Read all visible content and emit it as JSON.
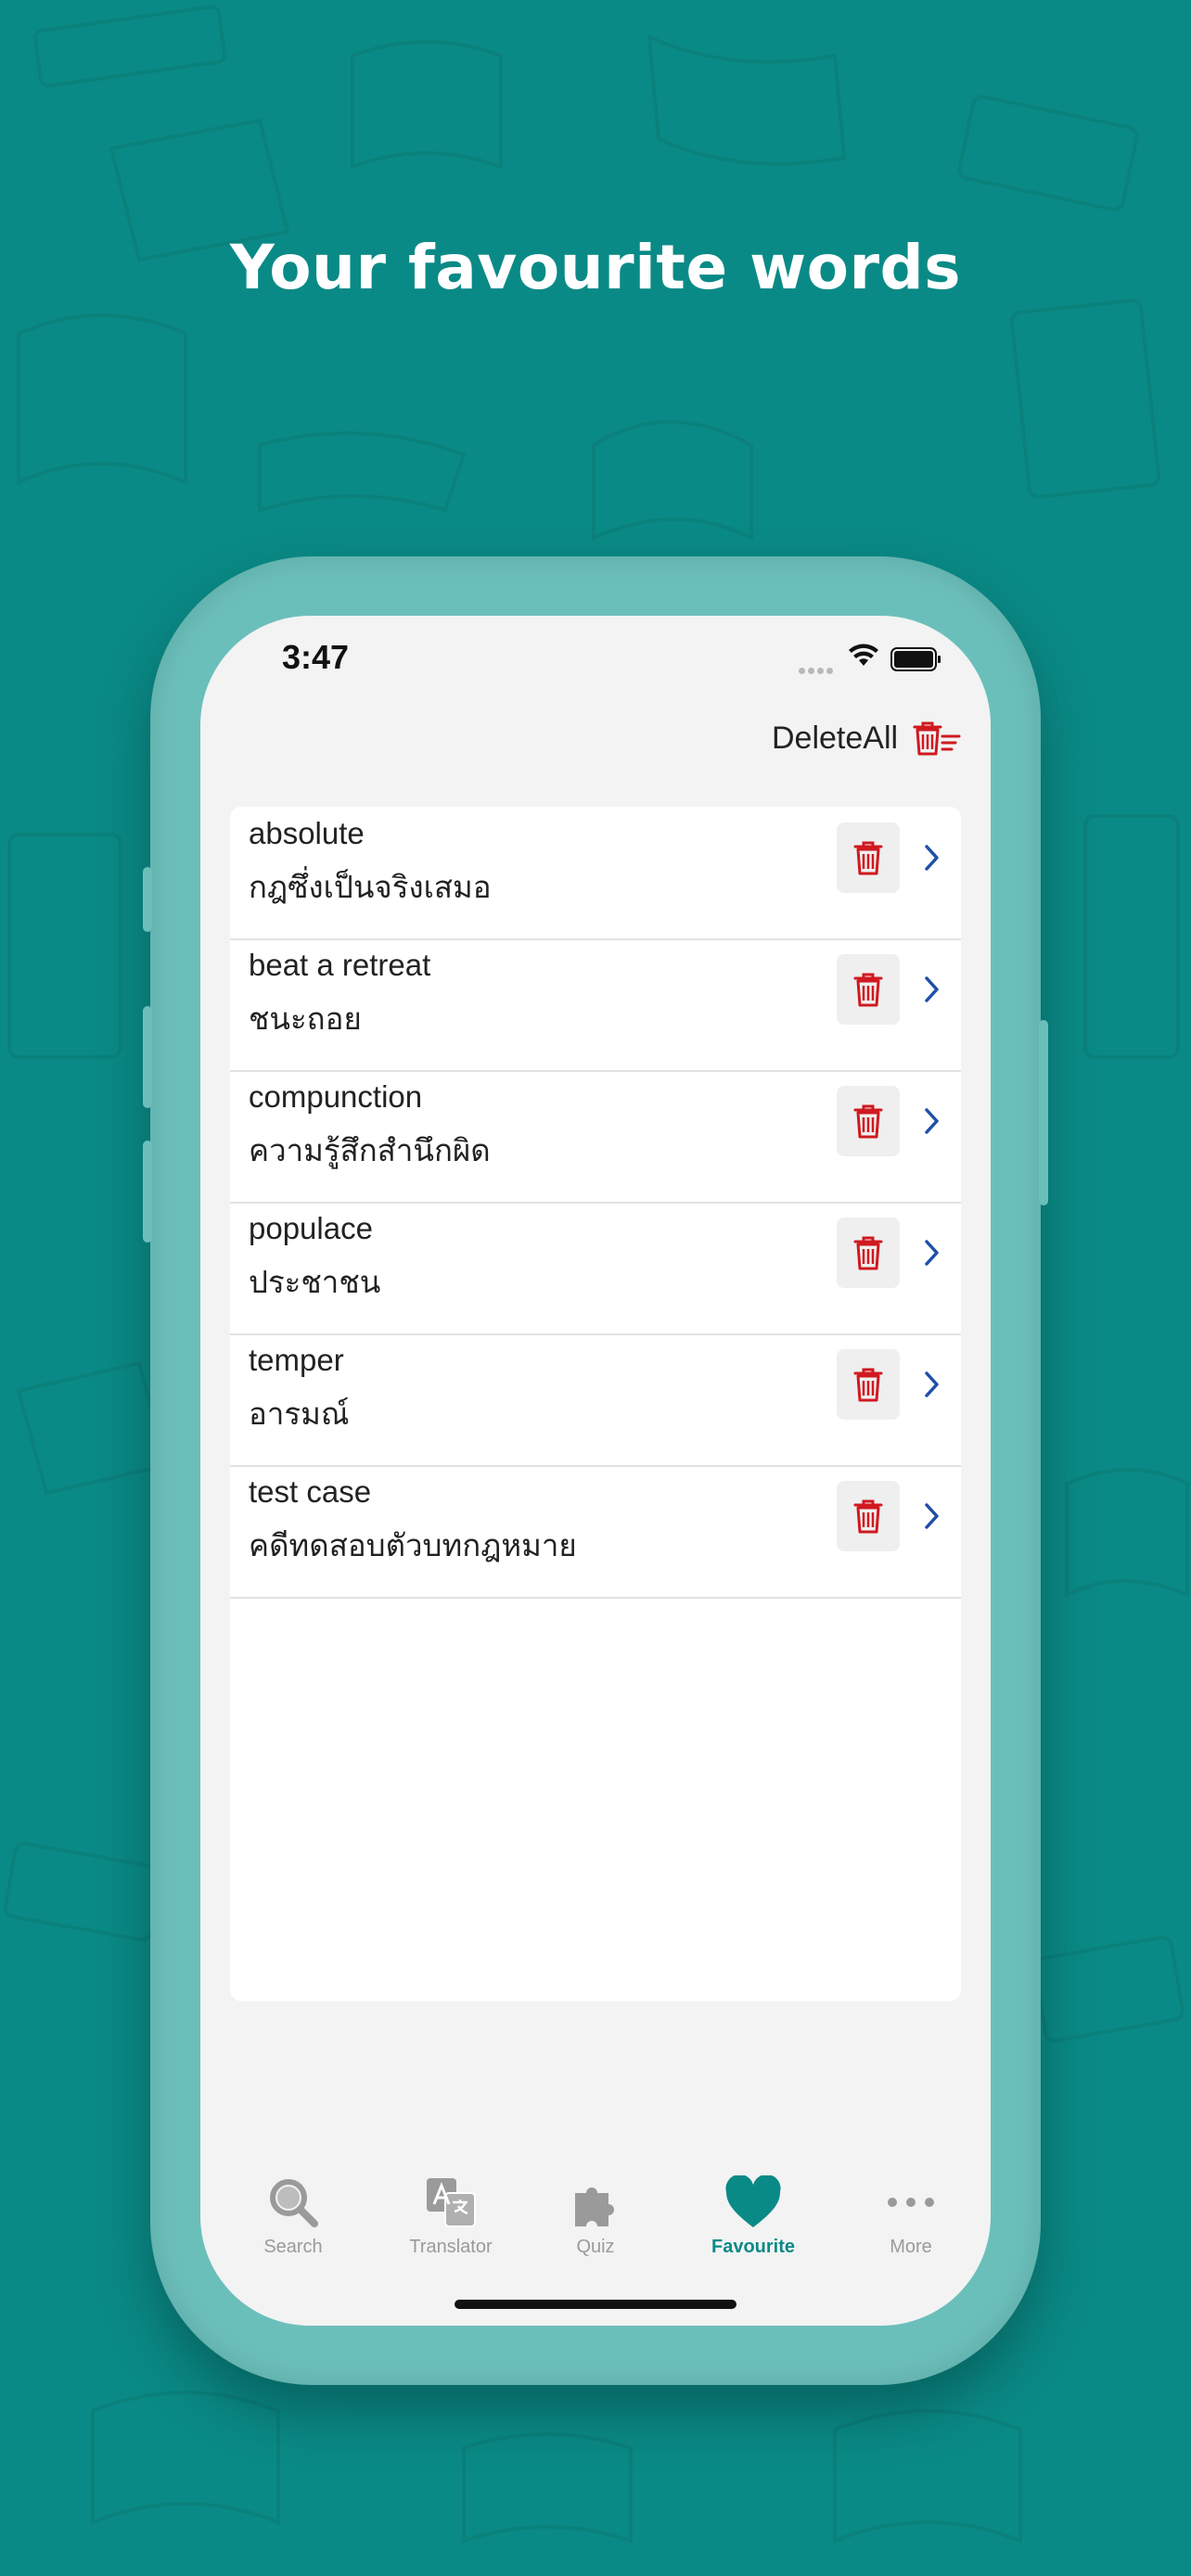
{
  "headline": "Your favourite words",
  "status_bar": {
    "time": "3:47"
  },
  "toolbar": {
    "delete_all_label": "DeleteAll"
  },
  "favourites": [
    {
      "word": "absolute",
      "translation": "กฎซึ่งเป็นจริงเสมอ"
    },
    {
      "word": "beat a retreat",
      "translation": "ชนะถอย"
    },
    {
      "word": "compunction",
      "translation": "ความรู้สึกสำนึกผิด"
    },
    {
      "word": "populace",
      "translation": "ประชาชน"
    },
    {
      "word": "temper",
      "translation": "อารมณ์"
    },
    {
      "word": "test case",
      "translation": "คดีทดสอบตัวบทกฎหมาย"
    }
  ],
  "tabs": [
    {
      "label": "Search",
      "icon": "search-icon",
      "active": false
    },
    {
      "label": "Translator",
      "icon": "translator-icon",
      "active": false
    },
    {
      "label": "Quiz",
      "icon": "puzzle-icon",
      "active": false
    },
    {
      "label": "Favourite",
      "icon": "heart-icon",
      "active": true
    },
    {
      "label": "More",
      "icon": "more-dots-icon",
      "active": false
    }
  ],
  "colors": {
    "background": "#0a8a86",
    "accent": "#0a8a86",
    "delete_red": "#d0191f",
    "chevron_blue": "#1f4fa8"
  }
}
